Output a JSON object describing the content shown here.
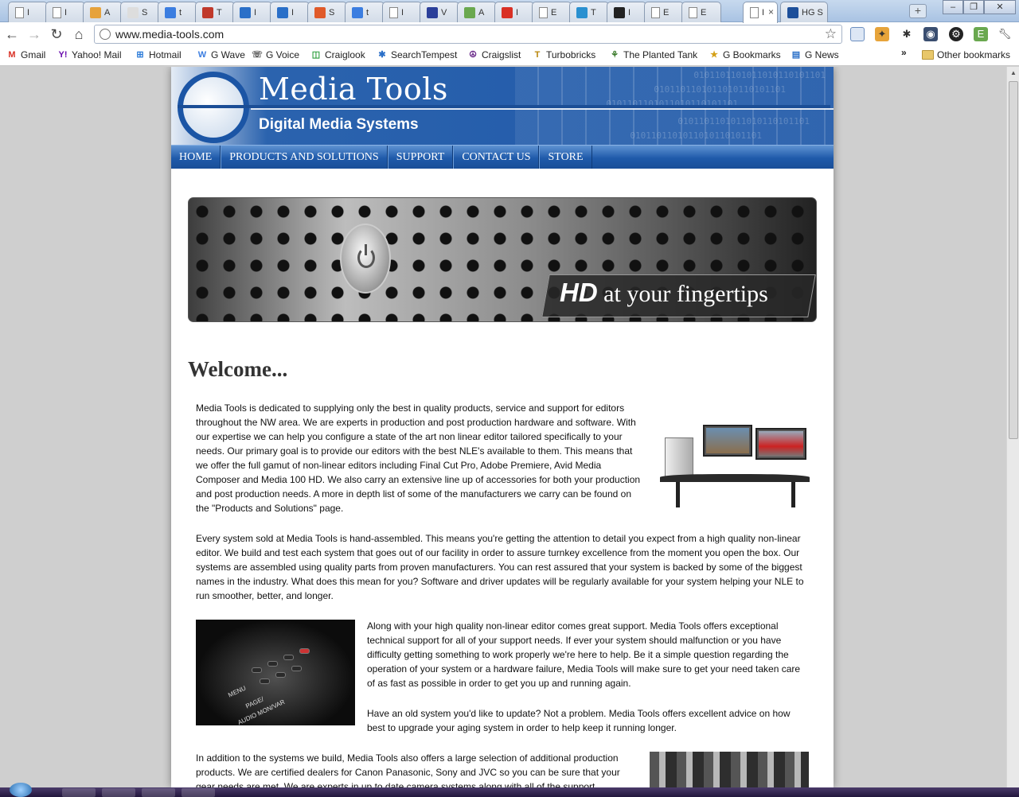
{
  "browser": {
    "tabs": [
      {
        "label": "I",
        "icon": "page-icon",
        "color": "#ffffff"
      },
      {
        "label": "I",
        "icon": "page-icon",
        "color": "#ffffff"
      },
      {
        "label": "A",
        "icon": "avatar-icon",
        "color": "#e6a23c"
      },
      {
        "label": "S",
        "icon": "chart-icon",
        "color": "#dddddd"
      },
      {
        "label": "t",
        "icon": "google-icon",
        "color": "#3b7de0"
      },
      {
        "label": "T",
        "icon": "code-icon",
        "color": "#c0392b"
      },
      {
        "label": "I",
        "icon": "s-logo-icon",
        "color": "#2a6fc8"
      },
      {
        "label": "I",
        "icon": "s-logo-icon",
        "color": "#2a6fc8"
      },
      {
        "label": "S",
        "icon": "s-logo-icon",
        "color": "#e05a2a"
      },
      {
        "label": "t",
        "icon": "google-icon",
        "color": "#3b7de0"
      },
      {
        "label": "I",
        "icon": "page-icon",
        "color": "#ffffff"
      },
      {
        "label": "V",
        "icon": "globe-icon",
        "color": "#2b3f9a"
      },
      {
        "label": "A",
        "icon": "flask-icon",
        "color": "#6aa84f"
      },
      {
        "label": "I",
        "icon": "gmail-icon",
        "color": "#d93025"
      },
      {
        "label": "E",
        "icon": "page-icon",
        "color": "#ffffff"
      },
      {
        "label": "T",
        "icon": "question-icon",
        "color": "#2a90d0"
      },
      {
        "label": "I",
        "icon": "image-icon",
        "color": "#222222"
      },
      {
        "label": "E",
        "icon": "page-icon",
        "color": "#ffffff"
      },
      {
        "label": "E",
        "icon": "page-icon",
        "color": "#ffffff"
      },
      {
        "label": "I",
        "icon": "page-icon",
        "color": "#ffffff",
        "active": true
      },
      {
        "label": "HG S",
        "icon": "hg-icon",
        "color": "#1d4f9a"
      }
    ],
    "url": "www.media-tools.com",
    "bookmarks": [
      {
        "label": "Gmail",
        "icon": "gmail-icon"
      },
      {
        "label": "Yahoo! Mail",
        "icon": "yahoo-icon"
      },
      {
        "label": "Hotmail",
        "icon": "windows-icon"
      },
      {
        "label": "G Wave",
        "icon": "wave-icon"
      },
      {
        "label": "G Voice",
        "icon": "phone-icon"
      },
      {
        "label": "Craiglook",
        "icon": "craiglook-icon"
      },
      {
        "label": "SearchTempest",
        "icon": "searchtempest-icon"
      },
      {
        "label": "Craigslist",
        "icon": "peace-icon"
      },
      {
        "label": "Turbobricks",
        "icon": "turbobricks-icon"
      },
      {
        "label": "The Planted Tank",
        "icon": "plant-icon"
      },
      {
        "label": "G Bookmarks",
        "icon": "bookmarks-icon"
      },
      {
        "label": "G News",
        "icon": "news-icon"
      }
    ],
    "overflow_chevron": "»",
    "other_bookmarks": "Other bookmarks"
  },
  "site": {
    "brand": "Media Tools",
    "tagline": "Digital Media Systems",
    "binary_pattern": "0101101101011010110101101",
    "nav": [
      "HOME",
      "PRODUCTS AND SOLUTIONS",
      "SUPPORT",
      "CONTACT US",
      "STORE"
    ],
    "banner": {
      "hd": "HD",
      "rest": "at your fingertips"
    },
    "welcome": "Welcome...",
    "paragraphs": [
      "Media Tools is dedicated to supplying only the best in quality products, service and support for editors throughout the NW area. We are experts in production and post production hardware and software. With our expertise we can help you configure a state of the art non linear editor tailored specifically to your needs. Our primary goal is to provide our editors with the best NLE's available to them. This means that we offer the full gamut of non-linear editors including Final Cut Pro, Adobe Premiere, Avid Media Composer and Media 100 HD. We also carry an extensive line up of accessories for both your production and post production needs. A more in depth list of some of the manufacturers we carry can be found on the \"Products and Solutions\" page.",
      "Every system sold at Media Tools is hand-assembled. This means you're getting the attention to detail you expect from a high quality non-linear editor. We build and test each system that goes out of our facility in order to assure turnkey excellence from the moment you open the box. Our systems are assembled using quality parts from proven manufacturers. You can rest assured that your system is backed by some of the biggest names in the industry. What does this mean for you? Software and driver updates will be regularly available for your system helping your NLE to run smoother, better, and longer.",
      "Along with your high quality non-linear editor comes great support. Media Tools offers exceptional technical support for all of your support needs. If ever your system should malfunction or you have difficulty getting something to work properly we're here to help. Be it a simple question regarding the operation of your system or a hardware failure, Media Tools will make sure to get your need taken care of as fast as possible in order to get you up and running again.",
      "Have an old system you'd like to update? Not a problem. Media Tools offers excellent advice on how best to upgrade your aging system in order to help keep it running longer.",
      "In addition to the systems we build, Media Tools also offers a large selection of additional production products. We are certified dealers for Canon Panasonic, Sony and JVC so you can be sure that your gear needs are met. We are experts in up to date camera systems along with all of the support"
    ],
    "remote_labels": [
      "MENU",
      "PAGE/",
      "AUDIO MON/VAR"
    ]
  }
}
